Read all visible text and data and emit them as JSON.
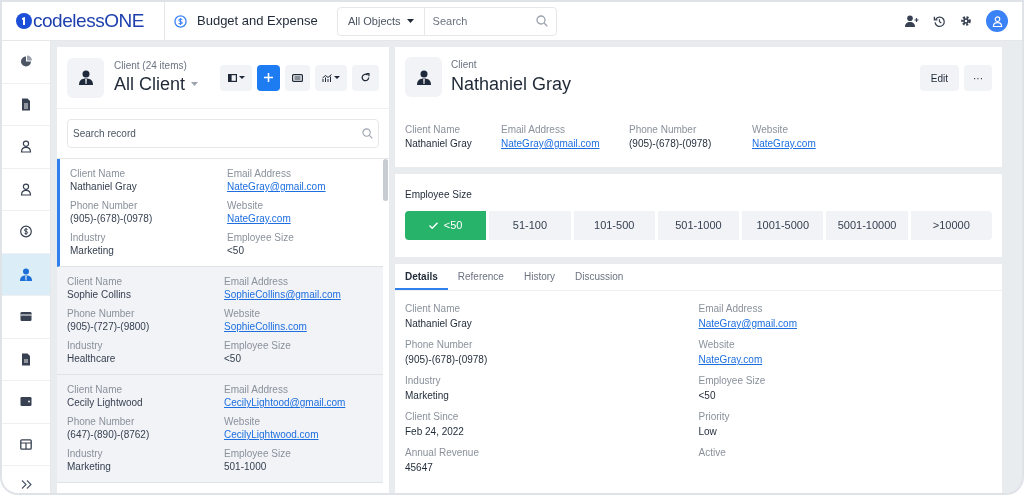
{
  "app": {
    "logo": "codelessONE",
    "module": "Budget and Expense"
  },
  "search": {
    "scope": "All Objects",
    "placeholder": "Search"
  },
  "sidebar": {
    "items": [
      {
        "kind": "pie",
        "selected": false
      },
      {
        "kind": "document",
        "selected": false
      },
      {
        "kind": "person",
        "selected": false
      },
      {
        "kind": "person",
        "selected": false
      },
      {
        "kind": "dollar",
        "selected": false
      },
      {
        "kind": "client",
        "selected": true
      },
      {
        "kind": "card",
        "selected": false
      },
      {
        "kind": "file",
        "selected": false
      },
      {
        "kind": "wallet",
        "selected": false
      },
      {
        "kind": "table",
        "selected": false
      }
    ]
  },
  "list": {
    "subtitle": "Client (24 items)",
    "title": "All Client",
    "search_placeholder": "Search record",
    "records": [
      {
        "selected": true,
        "fields": [
          {
            "label": "Client Name",
            "value": "Nathaniel Gray"
          },
          {
            "label": "Email Address",
            "value": "NateGray@gmail.com",
            "link": true
          },
          {
            "label": "Phone Number",
            "value": "(905)-(678)-(0978)"
          },
          {
            "label": "Website",
            "value": "NateGray.com",
            "link": true
          },
          {
            "label": "Industry",
            "value": "Marketing"
          },
          {
            "label": "Employee Size",
            "value": "<50"
          }
        ]
      },
      {
        "selected": false,
        "fields": [
          {
            "label": "Client Name",
            "value": "Sophie Collins"
          },
          {
            "label": "Email Address",
            "value": "SophieCollins@gmail.com",
            "link": true
          },
          {
            "label": "Phone Number",
            "value": "(905)-(727)-(9800)"
          },
          {
            "label": "Website",
            "value": "SophieCollins.com",
            "link": true
          },
          {
            "label": "Industry",
            "value": "Healthcare"
          },
          {
            "label": "Employee Size",
            "value": "<50"
          }
        ]
      },
      {
        "selected": false,
        "fields": [
          {
            "label": "Client Name",
            "value": "Cecily Lightwood"
          },
          {
            "label": "Email Address",
            "value": "CecilyLightood@gmail.com",
            "link": true
          },
          {
            "label": "Phone Number",
            "value": "(647)-(890)-(8762)"
          },
          {
            "label": "Website",
            "value": "CecilyLightwood.com",
            "link": true
          },
          {
            "label": "Industry",
            "value": "Marketing"
          },
          {
            "label": "Employee Size",
            "value": "501-1000"
          }
        ]
      }
    ]
  },
  "detail": {
    "type": "Client",
    "name": "Nathaniel Gray",
    "buttons": [
      "Edit",
      "···"
    ],
    "summary": [
      {
        "label": "Client Name",
        "value": "Nathaniel Gray"
      },
      {
        "label": "Email Address",
        "value": "NateGray@gmail.com",
        "link": true
      },
      {
        "label": "Phone Number",
        "value": "(905)-(678)-(0978)"
      },
      {
        "label": "Website",
        "value": "NateGray.com",
        "link": true
      }
    ],
    "employee_size": {
      "label": "Employee Size",
      "steps": [
        {
          "label": "<50",
          "selected": true
        },
        {
          "label": "51-100",
          "selected": false
        },
        {
          "label": "101-500",
          "selected": false
        },
        {
          "label": "501-1000",
          "selected": false
        },
        {
          "label": "1001-5000",
          "selected": false
        },
        {
          "label": "5001-10000",
          "selected": false
        },
        {
          "label": ">10000",
          "selected": false
        }
      ]
    },
    "tabs": [
      {
        "label": "Details",
        "selected": true
      },
      {
        "label": "Reference",
        "selected": false
      },
      {
        "label": "History",
        "selected": false
      },
      {
        "label": "Discussion",
        "selected": false
      }
    ],
    "fields": [
      {
        "label": "Client Name",
        "value": "Nathaniel Gray"
      },
      {
        "label": "Email Address",
        "value": "NateGray@gmail.com",
        "link": true
      },
      {
        "label": "Phone Number",
        "value": "(905)-(678)-(0978)"
      },
      {
        "label": "Website",
        "value": "NateGray.com",
        "link": true
      },
      {
        "label": "Industry",
        "value": "Marketing"
      },
      {
        "label": "Employee Size",
        "value": "<50"
      },
      {
        "label": "Client Since",
        "value": "Feb 24, 2022"
      },
      {
        "label": "Priority",
        "value": "Low"
      },
      {
        "label": "Annual Revenue",
        "value": "45647"
      },
      {
        "label": "Active"
      }
    ]
  }
}
